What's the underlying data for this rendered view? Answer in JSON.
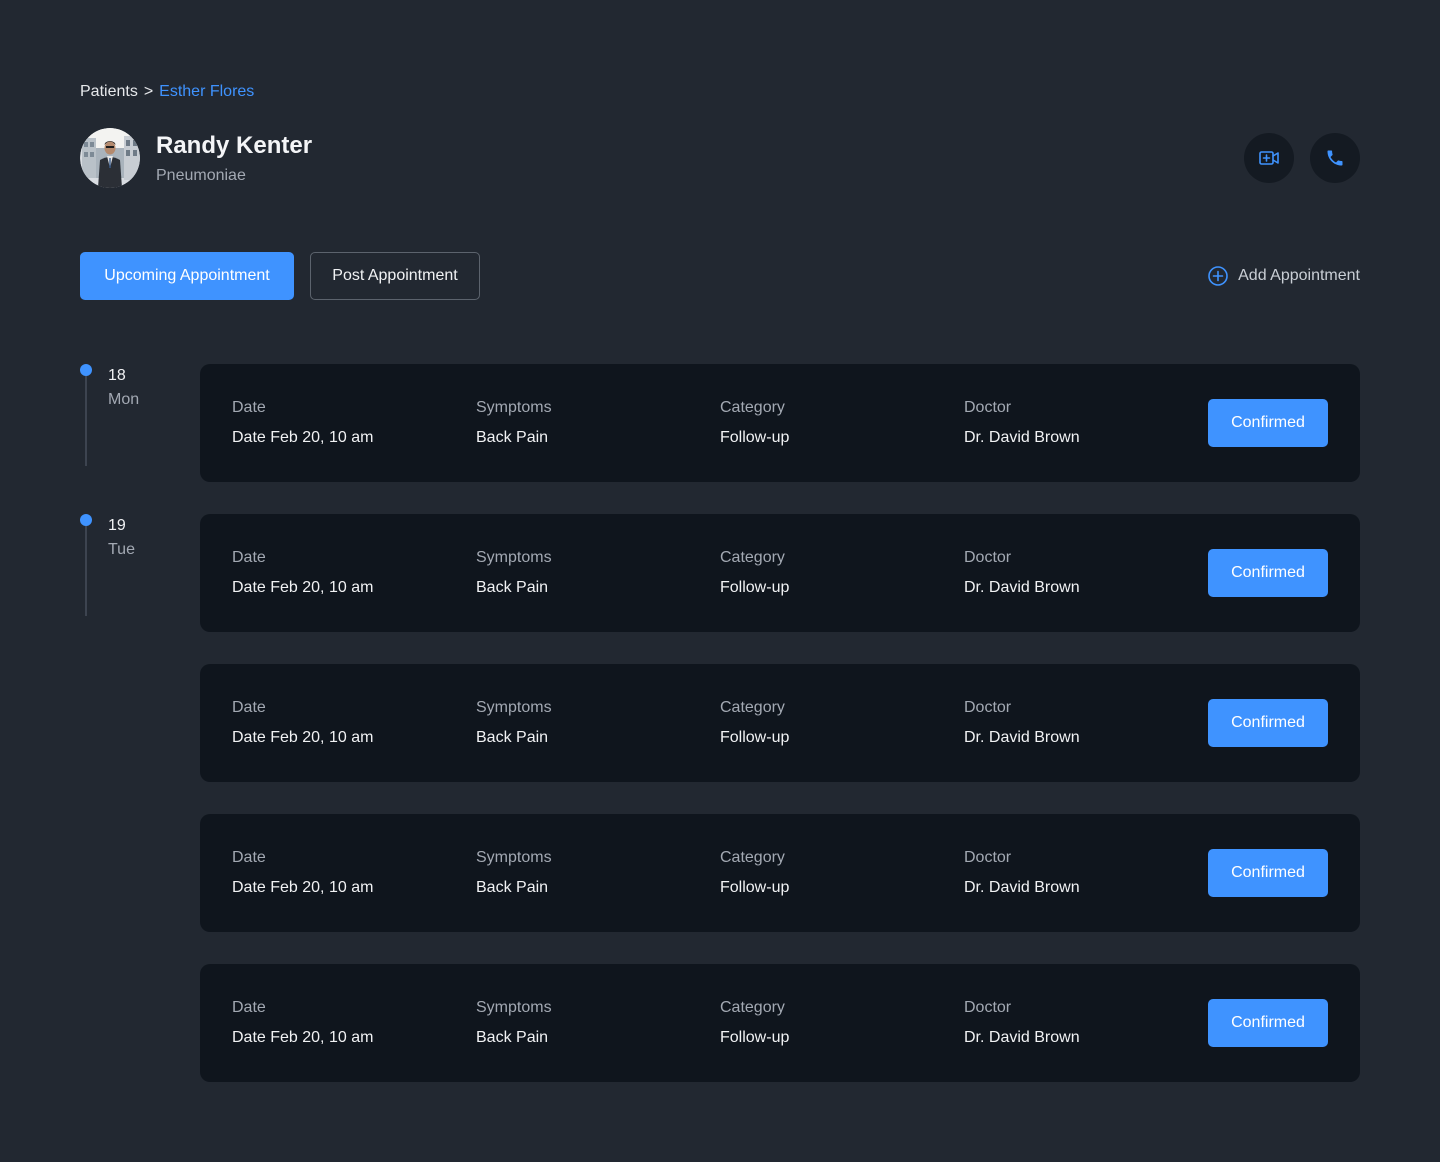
{
  "breadcrumb": {
    "root": "Patients",
    "separator": ">",
    "current": "Esther Flores"
  },
  "patient": {
    "name": "Randy Kenter",
    "condition": "Pneumoniae"
  },
  "actions": {
    "video_icon": "video-call-icon",
    "phone_icon": "phone-icon"
  },
  "tabs": [
    {
      "label": "Upcoming Appointment",
      "active": true
    },
    {
      "label": "Post Appointment",
      "active": false
    }
  ],
  "add_appointment": {
    "label": "Add Appointment",
    "icon": "plus-circle-icon"
  },
  "timeline": [
    {
      "day": "18",
      "weekday": "Mon"
    },
    {
      "day": "19",
      "weekday": "Tue"
    }
  ],
  "appointments": [
    {
      "date_label": "Date",
      "date": "Date Feb 20, 10 am",
      "symptoms_label": "Symptoms",
      "symptoms": "Back Pain",
      "category_label": "Category",
      "category": "Follow-up",
      "doctor_label": "Doctor",
      "doctor": "Dr. David Brown",
      "status": "Confirmed"
    },
    {
      "date_label": "Date",
      "date": "Date Feb 20, 10 am",
      "symptoms_label": "Symptoms",
      "symptoms": "Back Pain",
      "category_label": "Category",
      "category": "Follow-up",
      "doctor_label": "Doctor",
      "doctor": "Dr. David Brown",
      "status": "Confirmed"
    },
    {
      "date_label": "Date",
      "date": "Date Feb 20, 10 am",
      "symptoms_label": "Symptoms",
      "symptoms": "Back Pain",
      "category_label": "Category",
      "category": "Follow-up",
      "doctor_label": "Doctor",
      "doctor": "Dr. David Brown",
      "status": "Confirmed"
    },
    {
      "date_label": "Date",
      "date": "Date Feb 20, 10 am",
      "symptoms_label": "Symptoms",
      "symptoms": "Back Pain",
      "category_label": "Category",
      "category": "Follow-up",
      "doctor_label": "Doctor",
      "doctor": "Dr. David Brown",
      "status": "Confirmed"
    },
    {
      "date_label": "Date",
      "date": "Date Feb 20, 10 am",
      "symptoms_label": "Symptoms",
      "symptoms": "Back Pain",
      "category_label": "Category",
      "category": "Follow-up",
      "doctor_label": "Doctor",
      "doctor": "Dr. David Brown",
      "status": "Confirmed"
    }
  ],
  "colors": {
    "background": "#222831",
    "card": "#0f151d",
    "accent": "#3f93ff",
    "text_primary": "#f1f2f4",
    "text_secondary": "#a3a9b3"
  }
}
